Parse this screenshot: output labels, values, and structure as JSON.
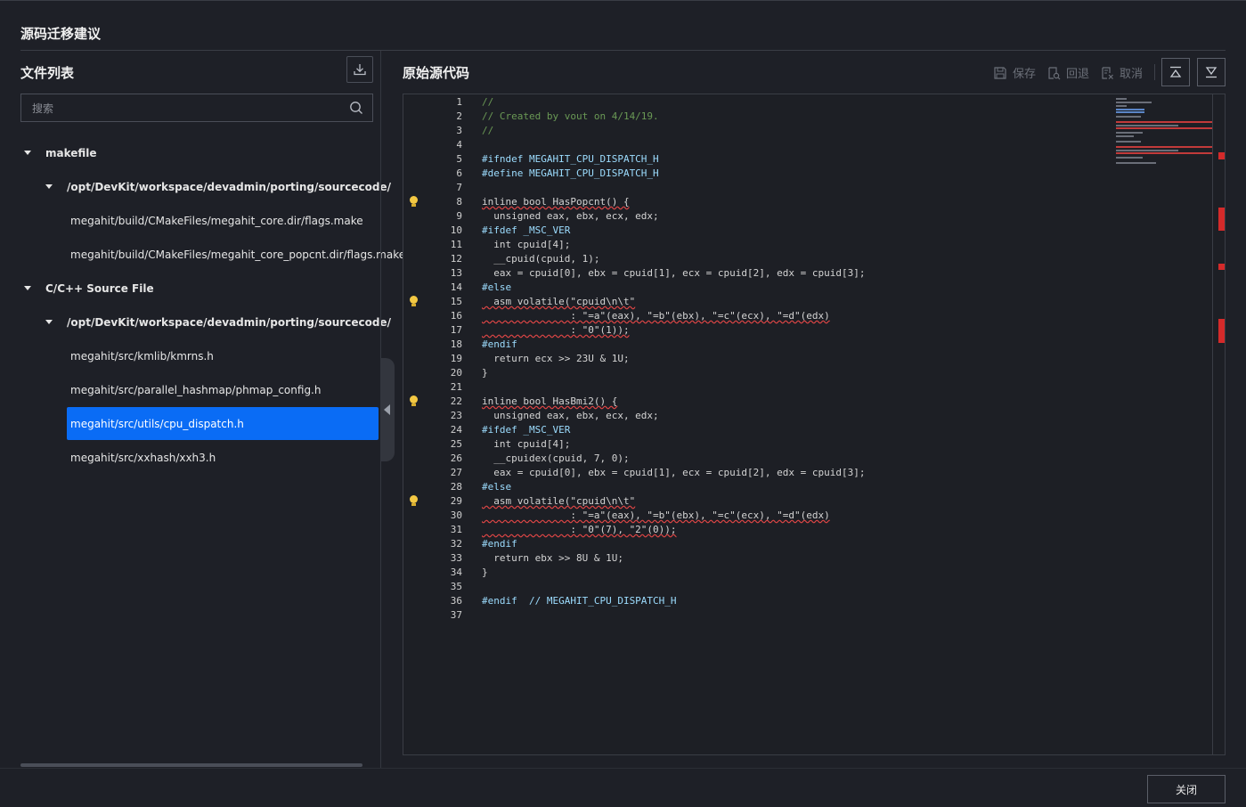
{
  "page": {
    "title": "源码迁移建议"
  },
  "left": {
    "title": "文件列表",
    "search_placeholder": "搜索",
    "groups": [
      {
        "label": "makefile",
        "folder": "/opt/DevKit/workspace/devadmin/porting/sourcecode/",
        "files": [
          "megahit/build/CMakeFiles/megahit_core.dir/flags.make",
          "megahit/build/CMakeFiles/megahit_core_popcnt.dir/flags.make"
        ]
      },
      {
        "label": "C/C++ Source File",
        "folder": "/opt/DevKit/workspace/devadmin/porting/sourcecode/",
        "files": [
          "megahit/src/kmlib/kmrns.h",
          "megahit/src/parallel_hashmap/phmap_config.h",
          "megahit/src/utils/cpu_dispatch.h",
          "megahit/src/xxhash/xxh3.h"
        ]
      }
    ],
    "selected_file": "megahit/src/utils/cpu_dispatch.h"
  },
  "right": {
    "title": "原始源代码",
    "toolbar": {
      "save": "保存",
      "revert": "回退",
      "cancel": "取消"
    }
  },
  "code": {
    "line_numbers": [
      "1",
      "2",
      "3",
      "4",
      "5",
      "6",
      "7",
      "8",
      "9",
      "10",
      "11",
      "12",
      "13",
      "14",
      "15",
      "16",
      "17",
      "18",
      "19",
      "20",
      "21",
      "22",
      "23",
      "24",
      "25",
      "26",
      "27",
      "28",
      "29",
      "30",
      "31",
      "32",
      "33",
      "34",
      "35",
      "36",
      "37"
    ],
    "lines": [
      "//",
      "// Created by vout on 4/14/19.",
      "//",
      "",
      "#ifndef MEGAHIT_CPU_DISPATCH_H",
      "#define MEGAHIT_CPU_DISPATCH_H",
      "",
      "inline bool HasPopcnt() {",
      "  unsigned eax, ebx, ecx, edx;",
      "#ifdef _MSC_VER",
      "  int cpuid[4];",
      "  __cpuid(cpuid, 1);",
      "  eax = cpuid[0], ebx = cpuid[1], ecx = cpuid[2], edx = cpuid[3];",
      "#else",
      "  asm volatile(\"cpuid\\n\\t\"",
      "               : \"=a\"(eax), \"=b\"(ebx), \"=c\"(ecx), \"=d\"(edx)",
      "               : \"0\"(1));",
      "#endif",
      "  return ecx >> 23U & 1U;",
      "}",
      "",
      "inline bool HasBmi2() {",
      "  unsigned eax, ebx, ecx, edx;",
      "#ifdef _MSC_VER",
      "  int cpuid[4];",
      "  __cpuidex(cpuid, 7, 0);",
      "  eax = cpuid[0], ebx = cpuid[1], ecx = cpuid[2], edx = cpuid[3];",
      "#else",
      "  asm volatile(\"cpuid\\n\\t\"",
      "               : \"=a\"(eax), \"=b\"(ebx), \"=c\"(ecx), \"=d\"(edx)",
      "               : \"0\"(7), \"2\"(0));",
      "#endif",
      "  return ebx >> 8U & 1U;",
      "}",
      "",
      "#endif  // MEGAHIT_CPU_DISPATCH_H",
      ""
    ],
    "warning_lines": [
      8,
      15,
      22,
      29
    ],
    "squiggle_lines": [
      8,
      15,
      16,
      17,
      22,
      29,
      30,
      31
    ]
  },
  "footer": {
    "close": "关闭"
  },
  "colors": {
    "accent": "#0a6cf5",
    "error": "#d42a2a",
    "warning": "#f3c843"
  }
}
